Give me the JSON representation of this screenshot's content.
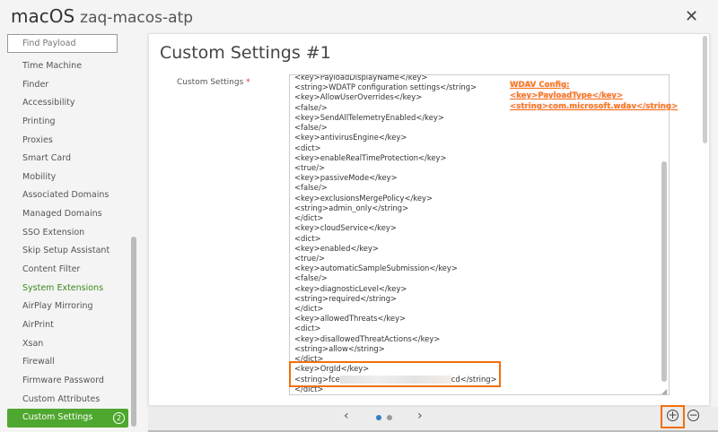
{
  "header": {
    "os": "macOS",
    "name": "zaq-macos-atp",
    "close_icon": "close-icon"
  },
  "sidebar": {
    "search_placeholder": "Find Payload",
    "items": [
      {
        "label": "Time Machine"
      },
      {
        "label": "Finder"
      },
      {
        "label": "Accessibility"
      },
      {
        "label": "Printing"
      },
      {
        "label": "Proxies"
      },
      {
        "label": "Smart Card"
      },
      {
        "label": "Mobility"
      },
      {
        "label": "Associated Domains"
      },
      {
        "label": "Managed Domains"
      },
      {
        "label": "SSO Extension"
      },
      {
        "label": "Skip Setup Assistant"
      },
      {
        "label": "Content Filter"
      },
      {
        "label": "System Extensions"
      },
      {
        "label": "AirPlay Mirroring"
      },
      {
        "label": "AirPrint"
      },
      {
        "label": "Xsan"
      },
      {
        "label": "Firewall"
      },
      {
        "label": "Firmware Password"
      },
      {
        "label": "Custom Attributes"
      },
      {
        "label": "Custom Settings",
        "badge": "2"
      }
    ]
  },
  "main": {
    "title": "Custom Settings #1",
    "field_label": "Custom Settings",
    "required_mark": "*",
    "lines": [
      "<key>PayloadDisplayName</key>",
      "<string>WDATP configuration settings</string>",
      "<key>AllowUserOverrides</key>",
      "<false/>",
      "<key>SendAllTelemetryEnabled</key>",
      "<false/>",
      "<key>antivirusEngine</key>",
      "<dict>",
      "<key>enableRealTimeProtection</key>",
      "<true/>",
      "<key>passiveMode</key>",
      "<false/>",
      "<key>exclusionsMergePolicy</key>",
      "<string>admin_only</string>",
      "</dict>",
      "<key>cloudService</key>",
      "<dict>",
      "<key>enabled</key>",
      "<true/>",
      "<key>automaticSampleSubmission</key>",
      "<false/>",
      "<key>diagnosticLevel</key>",
      "<string>required</string>",
      "</dict>",
      "<key>allowedThreats</key>",
      "<dict>",
      "<key>disallowedThreatActions</key>",
      "<string>allow</string>",
      "</dict>",
      "<key>OrgId</key>"
    ],
    "orgid_prefix": "<string>fce",
    "orgid_suffix": "cd</string>",
    "last_line": "</dict>",
    "annotation": [
      "WDAV Config:",
      "<key>PayloadType</key>",
      "<string>com.microsoft.wdav</string>"
    ]
  },
  "footer": {
    "prev": "‹",
    "next": "›",
    "pages": 2,
    "current_page": 1,
    "add_icon": "plus-circle-icon",
    "remove_icon": "minus-circle-icon"
  },
  "colors": {
    "accent_green": "#4ea72e",
    "highlight_orange": "#f26f0c"
  }
}
